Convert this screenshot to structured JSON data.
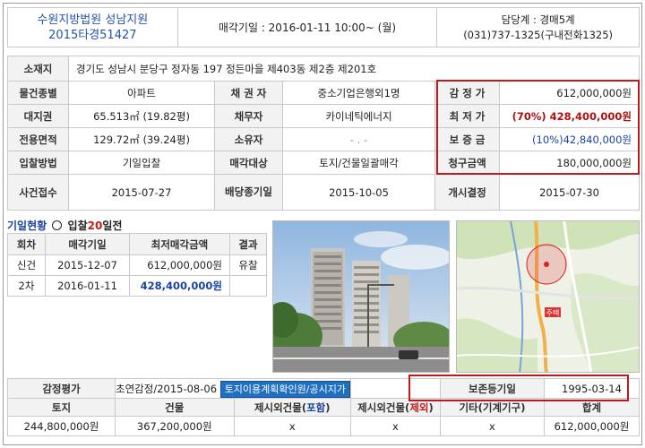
{
  "header": {
    "court": "수원지방법원 성남지원",
    "case_no": "2015타경51427",
    "sale_date": "매각기일 : 2016-01-11  10:00~ (월)",
    "dept": "담당계 : 경매5계",
    "phone": "(031)737-1325(구내전화1325)"
  },
  "info": {
    "addr_label": "소재지",
    "addr": "경기도 성남시 분당구 정자동 197 정든마을 제403동 제2층 제201호",
    "rows": [
      {
        "l1": "물건종별",
        "v1": "아파트",
        "l2": "채 권 자",
        "v2": "중소기업은행외1명",
        "l3": "감 정 가",
        "v3": "612,000,000원"
      },
      {
        "l1": "대지권",
        "v1": "65.513㎡ (19.82평)",
        "l2": "채무자",
        "v2": "카이네틱에너지",
        "l3": "최 저 가",
        "v3": "(70%) 428,400,000원"
      },
      {
        "l1": "전용면적",
        "v1": "129.72㎡ (39.24평)",
        "l2": "소유자",
        "v2": "- . -",
        "l3": "보 증 금",
        "v3": "(10%)42,840,000원"
      },
      {
        "l1": "입찰방법",
        "v1": "기일입찰",
        "l2": "매각대상",
        "v2": "토지/건물일괄매각",
        "l3": "청구금액",
        "v3": "180,000,000원"
      }
    ],
    "last": {
      "l1": "사건접수",
      "v1": "2015-07-27",
      "l2": "배당종기일",
      "v2": "2015-10-05",
      "l3": "개시결정",
      "v3": "2015-07-30"
    }
  },
  "history": {
    "title_a": "기일현황",
    "title_b": "입찰",
    "title_days": "20",
    "title_c": "일전",
    "headers": [
      "회차",
      "매각기일",
      "최저매각금액",
      "결과"
    ],
    "rows": [
      {
        "round": "신건",
        "date": "2015-12-07",
        "price": "612,000,000원",
        "result": "유찰"
      },
      {
        "round": "2차",
        "date": "2016-01-11",
        "price": "428,400,000원",
        "result": ""
      }
    ]
  },
  "appraisal": {
    "label": "감정평가",
    "value": "초연감정/2015-08-06",
    "button": "토지이용계획확인원/공시지가",
    "reg_label": "보존등기일",
    "reg_date": "1995-03-14"
  },
  "bottom": {
    "headers": [
      "토지",
      "건물",
      "제시외건물(포함)",
      "제시외건물(제외)",
      "기타(기계기구)",
      "합계"
    ],
    "values": [
      "244,800,000원",
      "367,200,000원",
      "x",
      "x",
      "x",
      "612,000,000원"
    ],
    "h3a": "제시외건물(",
    "h3b": "포함",
    "h4a": "제시외건물(",
    "h4b": "제외",
    "close": ")"
  },
  "map": {
    "marker": "주택"
  },
  "colors": {
    "accent_red": "#c0181c",
    "court_blue": "#2453a6",
    "link_blue": "#1f6fc2"
  }
}
